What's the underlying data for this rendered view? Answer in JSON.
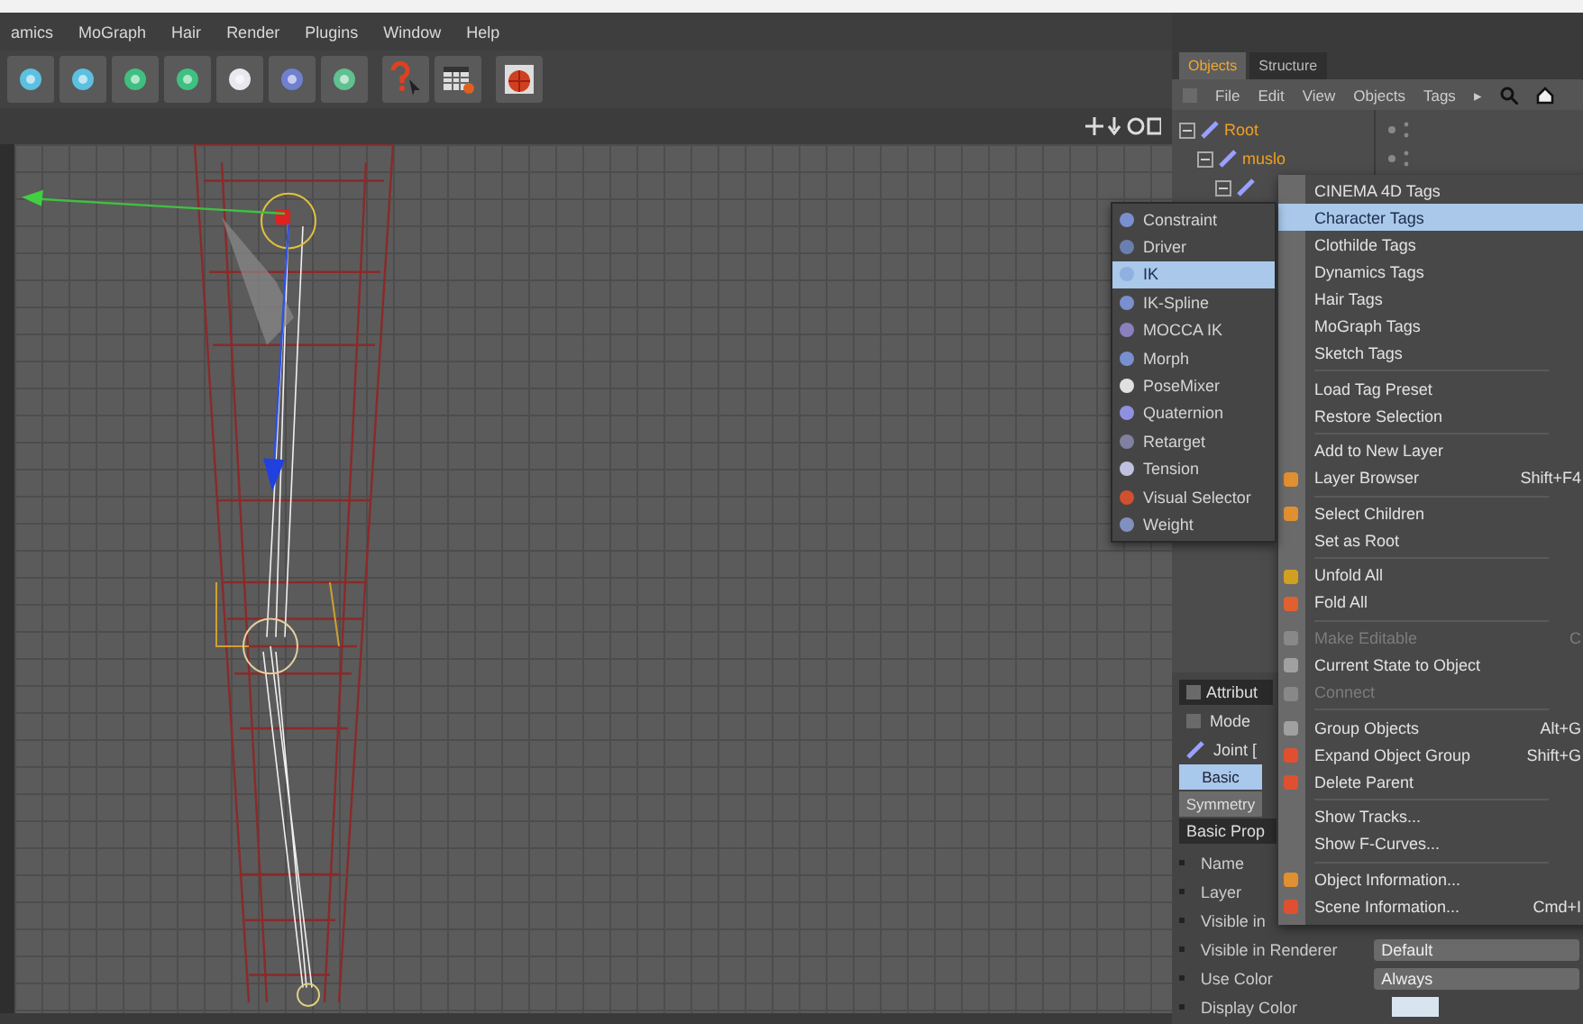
{
  "menu_bar": [
    "amics",
    "MoGraph",
    "Hair",
    "Render",
    "Plugins",
    "Window",
    "Help"
  ],
  "objects_panel": {
    "tabs": [
      {
        "label": "Objects",
        "selected": true
      },
      {
        "label": "Structure",
        "selected": false
      }
    ],
    "menu": [
      "File",
      "Edit",
      "View",
      "Objects",
      "Tags",
      "▸"
    ],
    "tree": [
      {
        "name": "Root",
        "children": [
          {
            "name": "muslo",
            "children": [
              {
                "kind": "joint"
              }
            ]
          }
        ]
      }
    ]
  },
  "attributes": {
    "title": "Attribut",
    "mode": "Mode",
    "object": "Joint [",
    "tabs": [
      {
        "label": "Basic",
        "selected": true
      },
      {
        "label": "Symmetry",
        "selected": false
      }
    ],
    "section": "Basic Prop",
    "rows": [
      {
        "label": "Name"
      },
      {
        "label": "Layer"
      },
      {
        "label": "Visible in"
      },
      {
        "label": "Visible in Renderer",
        "value": "Default"
      },
      {
        "label": "Use Color",
        "value": "Always"
      },
      {
        "label": "Display Color",
        "kind": "swatch"
      }
    ]
  },
  "context_menu": [
    {
      "kind": "item",
      "label": "CINEMA 4D Tags",
      "selected": false,
      "disabled": false,
      "icon": false
    },
    {
      "kind": "item",
      "label": "Character Tags",
      "selected": true,
      "disabled": false,
      "icon": false
    },
    {
      "kind": "item",
      "label": "Clothilde Tags",
      "selected": false,
      "disabled": false,
      "icon": false
    },
    {
      "kind": "item",
      "label": "Dynamics Tags",
      "selected": false,
      "disabled": false,
      "icon": false
    },
    {
      "kind": "item",
      "label": "Hair Tags",
      "selected": false,
      "disabled": false,
      "icon": false
    },
    {
      "kind": "item",
      "label": "MoGraph Tags",
      "selected": false,
      "disabled": false,
      "icon": false
    },
    {
      "kind": "item",
      "label": "Sketch Tags",
      "selected": false,
      "disabled": false,
      "icon": false
    },
    {
      "kind": "separator"
    },
    {
      "kind": "item",
      "label": "Load Tag Preset",
      "selected": false,
      "disabled": false,
      "icon": false
    },
    {
      "kind": "item",
      "label": "Restore Selection",
      "selected": false,
      "disabled": false,
      "icon": false
    },
    {
      "kind": "separator"
    },
    {
      "kind": "item",
      "label": "Add to New Layer",
      "selected": false,
      "disabled": false,
      "icon": false
    },
    {
      "kind": "item",
      "label": "Layer Browser",
      "shortcut": "Shift+F4",
      "selected": false,
      "disabled": false,
      "icon": true
    },
    {
      "kind": "separator"
    },
    {
      "kind": "item",
      "label": "Select Children",
      "selected": false,
      "disabled": false,
      "icon": true
    },
    {
      "kind": "item",
      "label": "Set as Root",
      "selected": false,
      "disabled": false,
      "icon": false
    },
    {
      "kind": "separator"
    },
    {
      "kind": "item",
      "label": "Unfold All",
      "selected": false,
      "disabled": false,
      "icon": true
    },
    {
      "kind": "item",
      "label": "Fold All",
      "selected": false,
      "disabled": false,
      "icon": true
    },
    {
      "kind": "separator"
    },
    {
      "kind": "item",
      "label": "Make Editable",
      "shortcut": "C",
      "selected": false,
      "disabled": true,
      "icon": true
    },
    {
      "kind": "item",
      "label": "Current State to Object",
      "selected": false,
      "disabled": false,
      "icon": true
    },
    {
      "kind": "item",
      "label": "Connect",
      "selected": false,
      "disabled": true,
      "icon": true
    },
    {
      "kind": "separator"
    },
    {
      "kind": "item",
      "label": "Group Objects",
      "shortcut": "Alt+G",
      "selected": false,
      "disabled": false,
      "icon": true
    },
    {
      "kind": "item",
      "label": "Expand Object Group",
      "shortcut": "Shift+G",
      "selected": false,
      "disabled": false,
      "icon": true
    },
    {
      "kind": "item",
      "label": "Delete Parent",
      "selected": false,
      "disabled": false,
      "icon": true
    },
    {
      "kind": "separator"
    },
    {
      "kind": "item",
      "label": "Show Tracks...",
      "selected": false,
      "disabled": false,
      "icon": false
    },
    {
      "kind": "item",
      "label": "Show F-Curves...",
      "selected": false,
      "disabled": false,
      "icon": false
    },
    {
      "kind": "separator"
    },
    {
      "kind": "item",
      "label": "Object Information...",
      "selected": false,
      "disabled": false,
      "icon": true
    },
    {
      "kind": "item",
      "label": "Scene Information...",
      "shortcut": "Cmd+I",
      "selected": false,
      "disabled": false,
      "icon": true
    }
  ],
  "submenu": [
    {
      "label": "Constraint",
      "selected": false
    },
    {
      "label": "Driver",
      "selected": false
    },
    {
      "label": "IK",
      "selected": true
    },
    {
      "label": "IK-Spline",
      "selected": false
    },
    {
      "label": "MOCCA IK",
      "selected": false
    },
    {
      "label": "Morph",
      "selected": false
    },
    {
      "label": "PoseMixer",
      "selected": false
    },
    {
      "label": "Quaternion",
      "selected": false
    },
    {
      "label": "Retarget",
      "selected": false
    },
    {
      "label": "Tension",
      "selected": false
    },
    {
      "label": "Visual Selector",
      "selected": false
    },
    {
      "label": "Weight",
      "selected": false
    }
  ]
}
